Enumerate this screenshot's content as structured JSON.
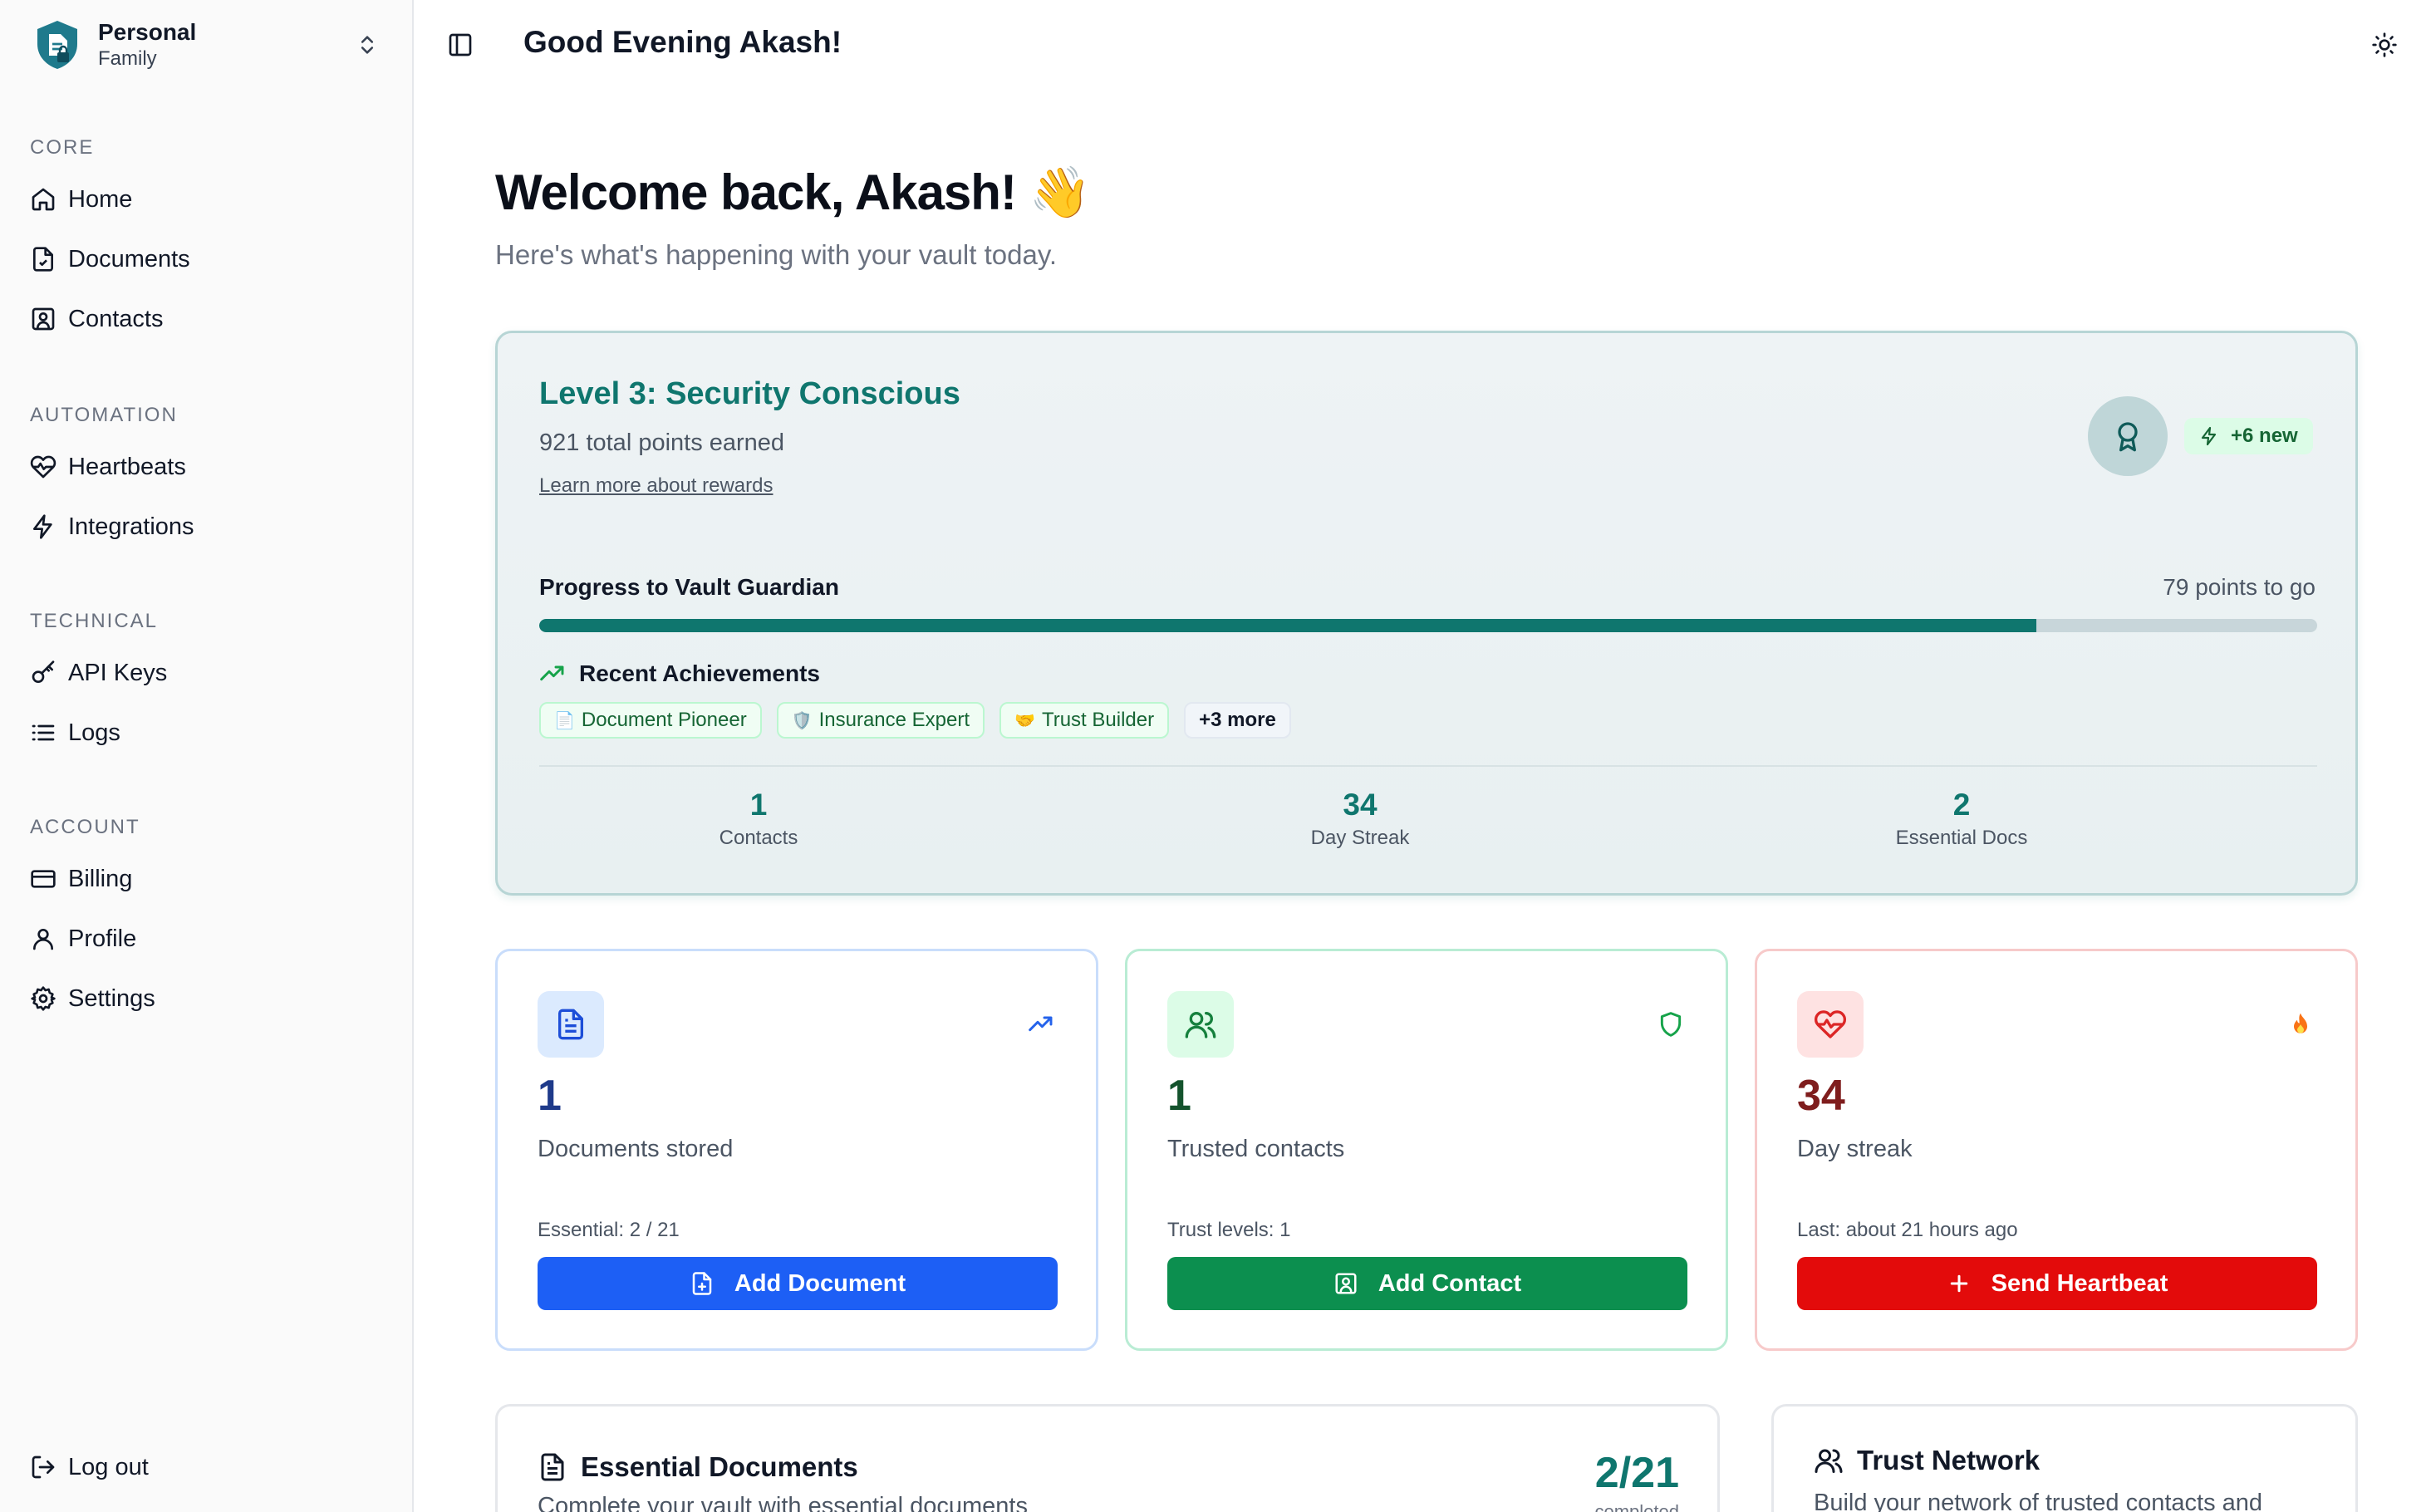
{
  "workspace": {
    "name": "Personal",
    "plan": "Family"
  },
  "sidebar": {
    "sections": [
      {
        "heading": "CORE",
        "items": [
          {
            "label": "Home",
            "icon": "home-icon"
          },
          {
            "label": "Documents",
            "icon": "document-icon"
          },
          {
            "label": "Contacts",
            "icon": "contacts-icon"
          }
        ]
      },
      {
        "heading": "AUTOMATION",
        "items": [
          {
            "label": "Heartbeats",
            "icon": "heartbeat-icon"
          },
          {
            "label": "Integrations",
            "icon": "lightning-icon"
          }
        ]
      },
      {
        "heading": "TECHNICAL",
        "items": [
          {
            "label": "API Keys",
            "icon": "key-icon"
          },
          {
            "label": "Logs",
            "icon": "list-icon"
          }
        ]
      },
      {
        "heading": "ACCOUNT",
        "items": [
          {
            "label": "Billing",
            "icon": "credit-card-icon"
          },
          {
            "label": "Profile",
            "icon": "user-icon"
          },
          {
            "label": "Settings",
            "icon": "gear-icon"
          }
        ]
      }
    ],
    "logout_label": "Log out"
  },
  "header": {
    "title": "Good Evening Akash!"
  },
  "main": {
    "welcome_title": "Welcome back, Akash! 👋",
    "welcome_sub": "Here's what's happening with your vault today."
  },
  "level_card": {
    "title": "Level 3: Security Conscious",
    "points_text": "921 total points earned",
    "rewards_link": "Learn more about rewards",
    "new_badge": "+6 new",
    "progress_label": "Progress to Vault Guardian",
    "points_to_go": "79 points to go",
    "progress_fraction": 0.842,
    "achievements_heading": "Recent Achievements",
    "achievements": [
      {
        "emoji": "📄",
        "label": "Document Pioneer"
      },
      {
        "emoji": "🛡️",
        "label": "Insurance Expert"
      },
      {
        "emoji": "🤝",
        "label": "Trust Builder"
      }
    ],
    "more_label": "+3 more",
    "stats": [
      {
        "value": "1",
        "label": "Contacts"
      },
      {
        "value": "34",
        "label": "Day Streak"
      },
      {
        "value": "2",
        "label": "Essential Docs"
      }
    ]
  },
  "cards": [
    {
      "number": "1",
      "label": "Documents stored",
      "meta": "Essential: 2 / 21",
      "button": "Add Document",
      "icon": "document-icon",
      "corner_icon": "trending-up-icon",
      "accent": "#1d4ed8",
      "button_color": "#1d5ff5"
    },
    {
      "number": "1",
      "label": "Trusted contacts",
      "meta": "Trust levels: 1",
      "button": "Add Contact",
      "icon": "users-icon",
      "corner_icon": "shield-icon",
      "accent": "#166534",
      "button_color": "#0c8f4f"
    },
    {
      "number": "34",
      "label": "Day streak",
      "meta": "Last: about 21 hours ago",
      "button": "Send Heartbeat",
      "icon": "heartbeat-icon",
      "corner_icon": "fire-icon",
      "accent": "#991b1b",
      "button_color": "#e30b0b"
    }
  ],
  "essential_docs": {
    "title": "Essential Documents",
    "subtitle": "Complete your vault with essential documents",
    "count": "2/21",
    "count_sub": "completed"
  },
  "trust_network": {
    "title": "Trust Network",
    "subtitle": "Build your network of trusted contacts and"
  }
}
